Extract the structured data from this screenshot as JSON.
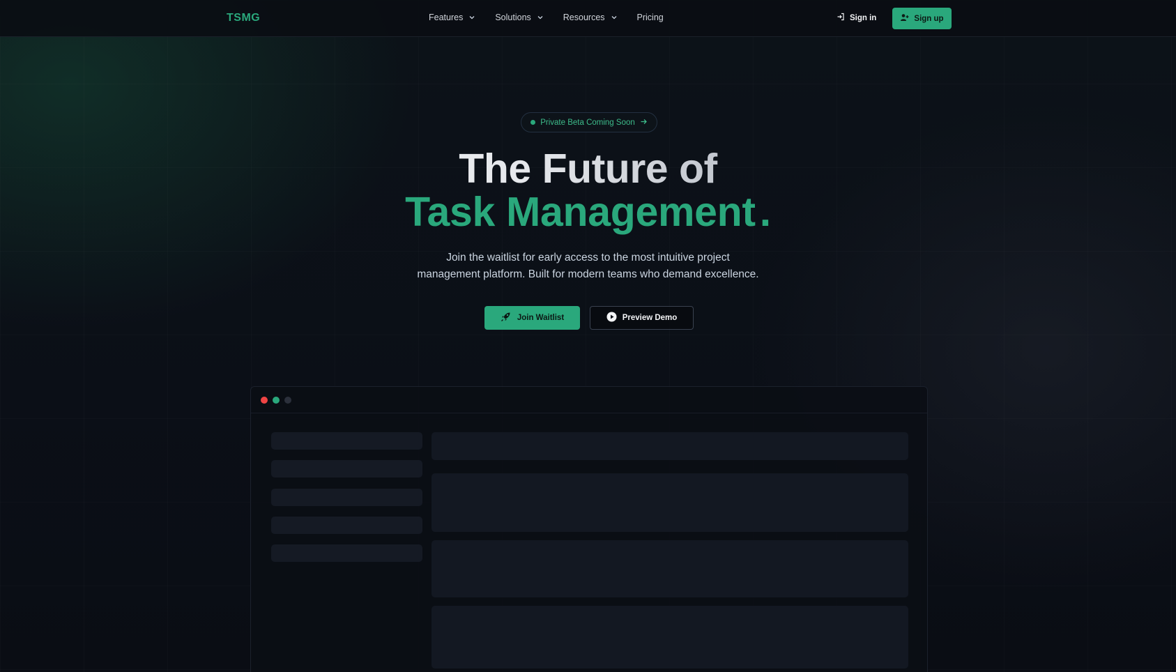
{
  "nav": {
    "logo": "TSMG",
    "menu": [
      {
        "label": "Features",
        "has_dropdown": true
      },
      {
        "label": "Solutions",
        "has_dropdown": true
      },
      {
        "label": "Resources",
        "has_dropdown": true
      },
      {
        "label": "Pricing",
        "has_dropdown": false
      }
    ],
    "sign_in_label": "Sign in",
    "sign_in_icon": "log-in-icon",
    "sign_up_label": "Sign up",
    "sign_up_icon": "user-plus-icon"
  },
  "hero": {
    "badge_text": "Private Beta Coming Soon",
    "badge_icon": "arrow-right-icon",
    "title_line1": "The Future of",
    "title_line2": "Task Management",
    "title_dot": ".",
    "subtitle_line1": "Join the waitlist for early access to the most intuitive project",
    "subtitle_line2": "management platform. Built for modern teams who demand excellence.",
    "primary_cta": "Join Waitlist",
    "primary_cta_icon": "rocket-icon",
    "secondary_cta": "Preview Demo",
    "secondary_cta_icon": "play-circle-icon"
  },
  "colors": {
    "accent": "#2aa87c",
    "background": "#0b0f17",
    "traffic_red": "#ef4444",
    "traffic_green": "#2aa87c",
    "traffic_gray": "#2b303b"
  }
}
